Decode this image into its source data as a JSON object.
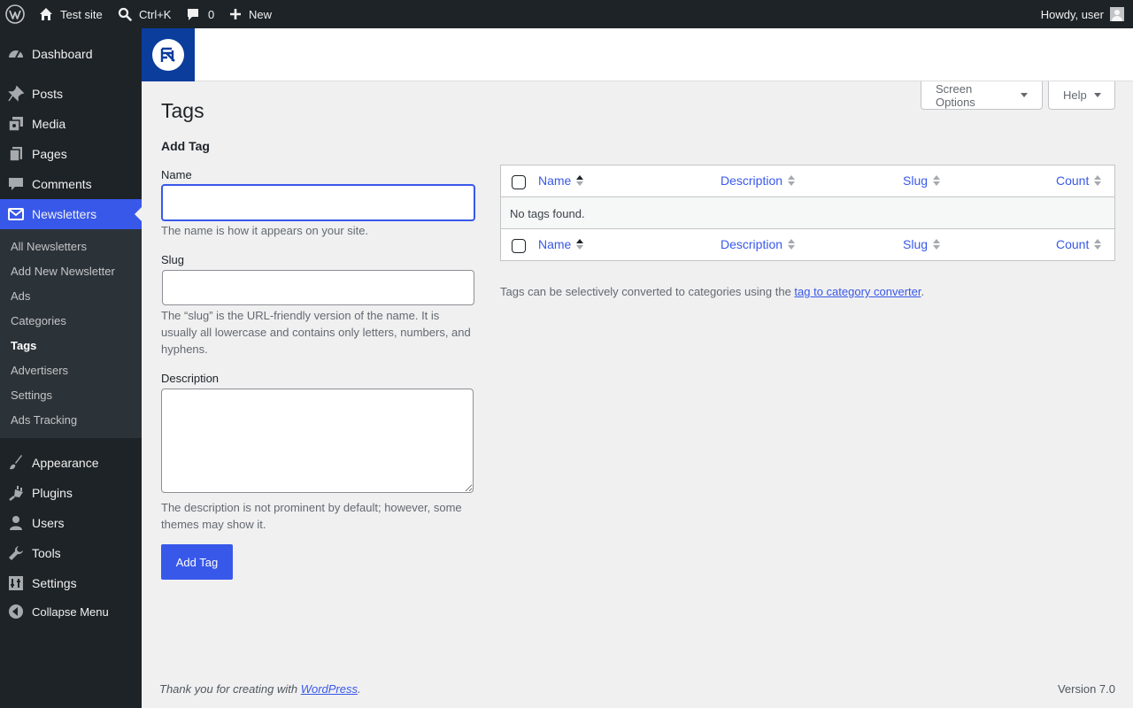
{
  "admin_bar": {
    "site_name": "Test site",
    "search_shortcut": "Ctrl+K",
    "comments_count": "0",
    "new_label": "New",
    "howdy": "Howdy, user"
  },
  "sidebar": {
    "items": [
      {
        "label": "Dashboard",
        "icon": "dashboard-icon"
      },
      {
        "label": "Posts",
        "icon": "pushpin-icon"
      },
      {
        "label": "Media",
        "icon": "media-icon"
      },
      {
        "label": "Pages",
        "icon": "pages-icon"
      },
      {
        "label": "Comments",
        "icon": "comment-icon"
      },
      {
        "label": "Newsletters",
        "icon": "envelope-icon"
      },
      {
        "label": "Appearance",
        "icon": "paintbrush-icon"
      },
      {
        "label": "Plugins",
        "icon": "plugin-icon"
      },
      {
        "label": "Users",
        "icon": "user-icon"
      },
      {
        "label": "Tools",
        "icon": "wrench-icon"
      },
      {
        "label": "Settings",
        "icon": "settings-icon"
      }
    ],
    "submenu": [
      "All Newsletters",
      "Add New Newsletter",
      "Ads",
      "Categories",
      "Tags",
      "Advertisers",
      "Settings",
      "Ads Tracking"
    ],
    "collapse_label": "Collapse Menu"
  },
  "header": {
    "screen_options": "Screen Options",
    "help": "Help"
  },
  "page": {
    "title": "Tags",
    "form_title": "Add Tag",
    "name_label": "Name",
    "name_value": "",
    "name_desc": "The name is how it appears on your site.",
    "slug_label": "Slug",
    "slug_value": "",
    "slug_desc": "The “slug” is the URL-friendly version of the name. It is usually all lowercase and contains only letters, numbers, and hyphens.",
    "desc_label": "Description",
    "desc_value": "",
    "desc_desc": "The description is not prominent by default; however, some themes may show it.",
    "submit_label": "Add Tag"
  },
  "table": {
    "columns": [
      "Name",
      "Description",
      "Slug",
      "Count"
    ],
    "empty_message": "No tags found."
  },
  "note": {
    "prefix": "Tags can be selectively converted to categories using the ",
    "link": "tag to category converter",
    "suffix": "."
  },
  "footer": {
    "thanks_prefix": "Thank you for creating with ",
    "thanks_link": "WordPress",
    "thanks_suffix": ".",
    "version": "Version 7.0"
  },
  "colors": {
    "accent": "#3858e9",
    "sidebar_bg": "#1d2327",
    "plugin_logo_bg": "#0a3d9c"
  }
}
